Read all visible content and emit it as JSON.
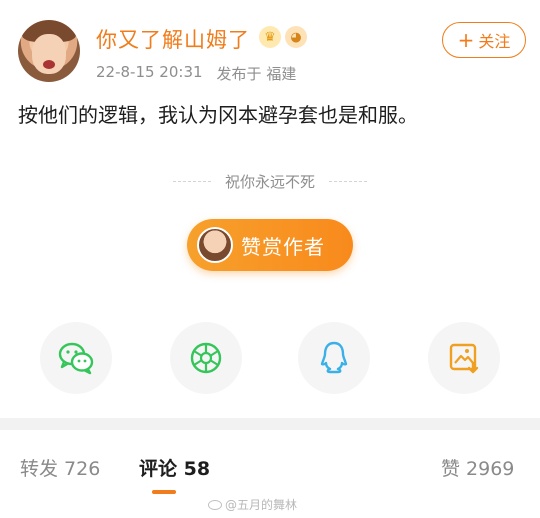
{
  "post": {
    "username": "你又了解山姆了",
    "badges": [
      {
        "icon": "crown-badge-icon",
        "glyph": "♛"
      },
      {
        "icon": "fish-badge-icon",
        "glyph": "◕"
      }
    ],
    "timestamp": "22-8-15 20:31",
    "location": "发布于 福建",
    "follow_label": "关注",
    "follow_prefix": "+",
    "text": "按他们的逻辑，我认为冈本避孕套也是和服。"
  },
  "blessing": "祝你永远不死",
  "reward": {
    "label": "赞赏作者"
  },
  "share": [
    {
      "name": "wechat",
      "icon": "wechat-icon"
    },
    {
      "name": "moments",
      "icon": "moments-icon"
    },
    {
      "name": "qq",
      "icon": "qq-icon"
    },
    {
      "name": "save-image",
      "icon": "save-image-icon"
    }
  ],
  "tabs": {
    "repost": "转发 726",
    "comments": "评论 58",
    "likes": "赞 2969"
  },
  "watermark": "@五月的舞林",
  "colors": {
    "accent": "#f07c1b",
    "wechat": "#35c55b",
    "qq": "#3ab0e8",
    "save": "#f0a020"
  }
}
